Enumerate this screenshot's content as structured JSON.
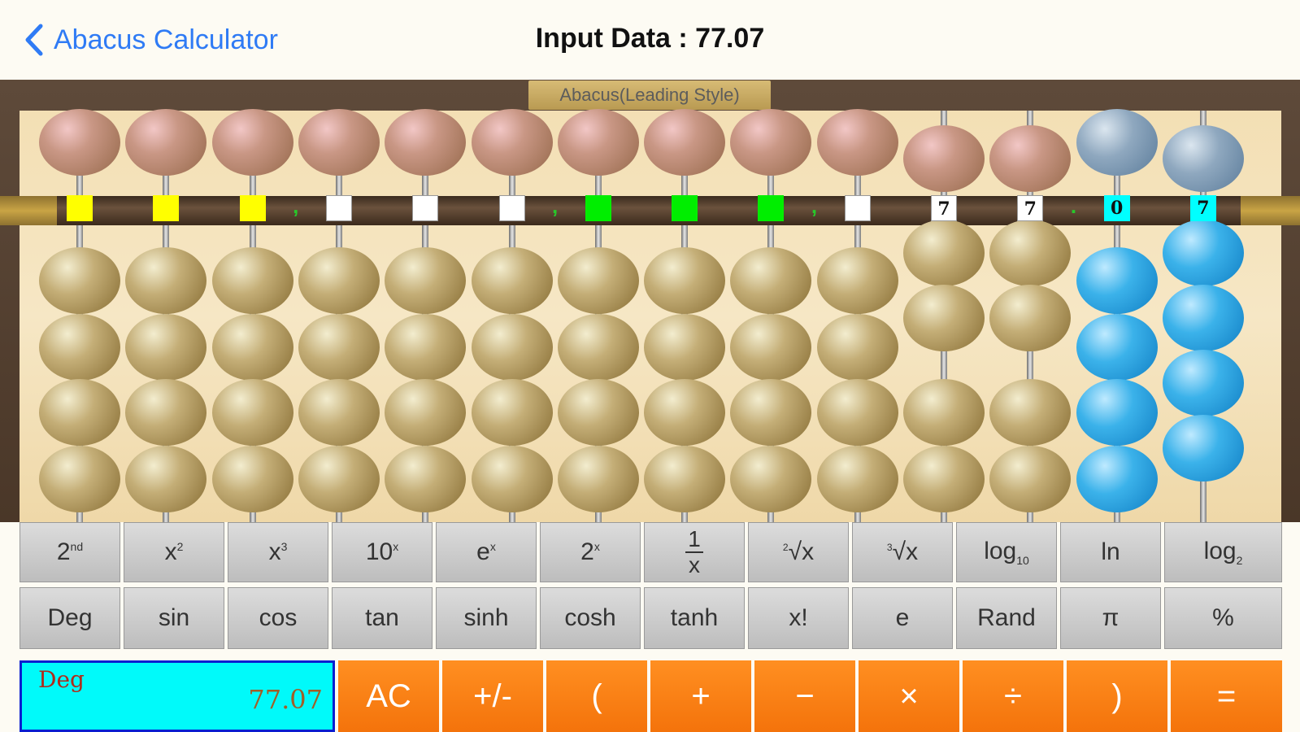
{
  "navbar": {
    "back_label": "Abacus Calculator",
    "title": "Input Data : 77.07"
  },
  "abacus": {
    "title": "Abacus(Leading Style)",
    "rods": [
      {
        "upper_active": false,
        "lower_count": 0,
        "marker": "",
        "marker_color": "#ffff00"
      },
      {
        "upper_active": false,
        "lower_count": 0,
        "marker": "",
        "marker_color": "#ffff00"
      },
      {
        "upper_active": false,
        "lower_count": 0,
        "marker": "",
        "marker_color": "#ffff00"
      },
      {
        "upper_active": false,
        "lower_count": 0,
        "marker": "",
        "marker_color": "#ffffff"
      },
      {
        "upper_active": false,
        "lower_count": 0,
        "marker": "",
        "marker_color": "#ffffff"
      },
      {
        "upper_active": false,
        "lower_count": 0,
        "marker": "",
        "marker_color": "#ffffff"
      },
      {
        "upper_active": false,
        "lower_count": 0,
        "marker": "",
        "marker_color": "#00ee00"
      },
      {
        "upper_active": false,
        "lower_count": 0,
        "marker": "",
        "marker_color": "#00ee00"
      },
      {
        "upper_active": false,
        "lower_count": 0,
        "marker": "",
        "marker_color": "#00ee00"
      },
      {
        "upper_active": false,
        "lower_count": 0,
        "marker": "",
        "marker_color": "#ffffff"
      },
      {
        "upper_active": true,
        "lower_count": 2,
        "marker": "7",
        "marker_color": "#ffffff"
      },
      {
        "upper_active": true,
        "lower_count": 2,
        "marker": "7",
        "marker_color": "#ffffff"
      },
      {
        "upper_active": false,
        "lower_count": 0,
        "marker": "0",
        "marker_color": "#00ffff",
        "highlight": true
      },
      {
        "upper_active": true,
        "lower_count": 2,
        "marker": "7",
        "marker_color": "#00ffff",
        "highlight": true
      }
    ],
    "separators": [
      ",",
      ",",
      ",",
      "."
    ]
  },
  "keypad": {
    "row1": [
      "2nd",
      "x2",
      "x3",
      "10x",
      "ex",
      "2x",
      "1/x",
      "2√x",
      "3√x",
      "log10",
      "ln",
      "log2"
    ],
    "row2": [
      "Deg",
      "sin",
      "cos",
      "tan",
      "sinh",
      "cosh",
      "tanh",
      "x!",
      "e",
      "Rand",
      "π",
      "%"
    ],
    "row3": [
      "AC",
      "+/-",
      "(",
      "+",
      "−",
      "×",
      "÷",
      ")",
      "="
    ]
  },
  "display": {
    "mode": "Deg",
    "value": "77.07"
  },
  "colors": {
    "accent": "#2f7bf5",
    "operator_key": "#f57f14",
    "display_bg": "#00fafa"
  }
}
